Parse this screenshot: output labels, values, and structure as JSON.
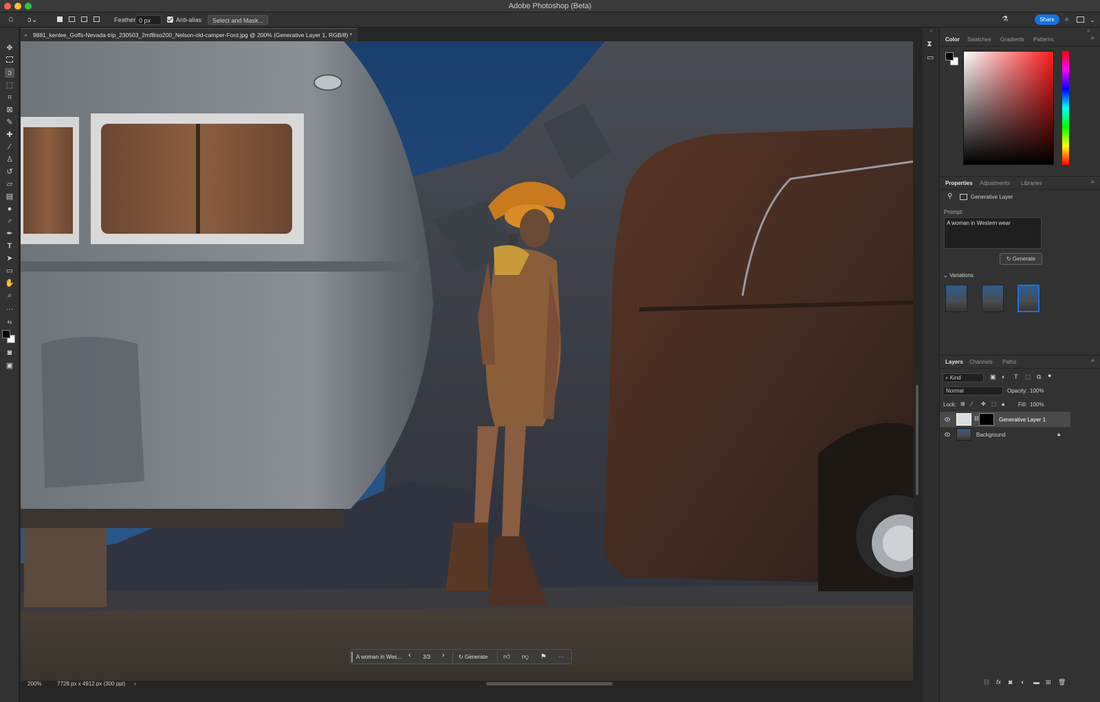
{
  "window": {
    "title": "Adobe Photoshop (Beta)"
  },
  "options_bar": {
    "feather_label": "Feather:",
    "feather_value": "0 px",
    "antialias_label": "Anti-alias",
    "select_mask_label": "Select and Mask...",
    "share_label": "Share"
  },
  "document": {
    "tab_title": "9881_kenlee_Goffs-Nevada-trip_230503_2mf8iso200_Nelson-old-camper-Ford.jpg @ 200% (Generative Layer 1, RGB/8) *"
  },
  "color_panel": {
    "tabs": [
      "Color",
      "Swatches",
      "Gradients",
      "Patterns"
    ],
    "hue_color": "#ff1a1a"
  },
  "properties_panel": {
    "tabs": [
      "Properties",
      "Adjustments",
      "Libraries"
    ],
    "layer_type": "Generative Layer",
    "prompt_label": "Prompt:",
    "prompt_text": "A woman in Western wear",
    "generate_label": "Generate",
    "variations_label": "Variations"
  },
  "layers_panel": {
    "tabs": [
      "Layers",
      "Channels",
      "Paths"
    ],
    "filter_label": "Kind",
    "blend_mode": "Normal",
    "opacity_label": "Opacity:",
    "opacity_value": "100%",
    "lock_label": "Lock:",
    "fill_label": "Fill:",
    "fill_value": "100%",
    "layers": [
      {
        "name": "Generative Layer 1",
        "selected": true
      },
      {
        "name": "Background",
        "selected": false
      }
    ]
  },
  "contextual_bar": {
    "prompt_text": "A woman in Wes...",
    "variation_counter": "3/3",
    "generate_label": "Generate"
  },
  "status_bar": {
    "zoom": "200%",
    "doc_info": "7728 px x 4912 px (300 ppi)"
  },
  "colors": {
    "accent": "#1473e6",
    "panel_bg": "#323232",
    "app_bg": "#262626"
  }
}
